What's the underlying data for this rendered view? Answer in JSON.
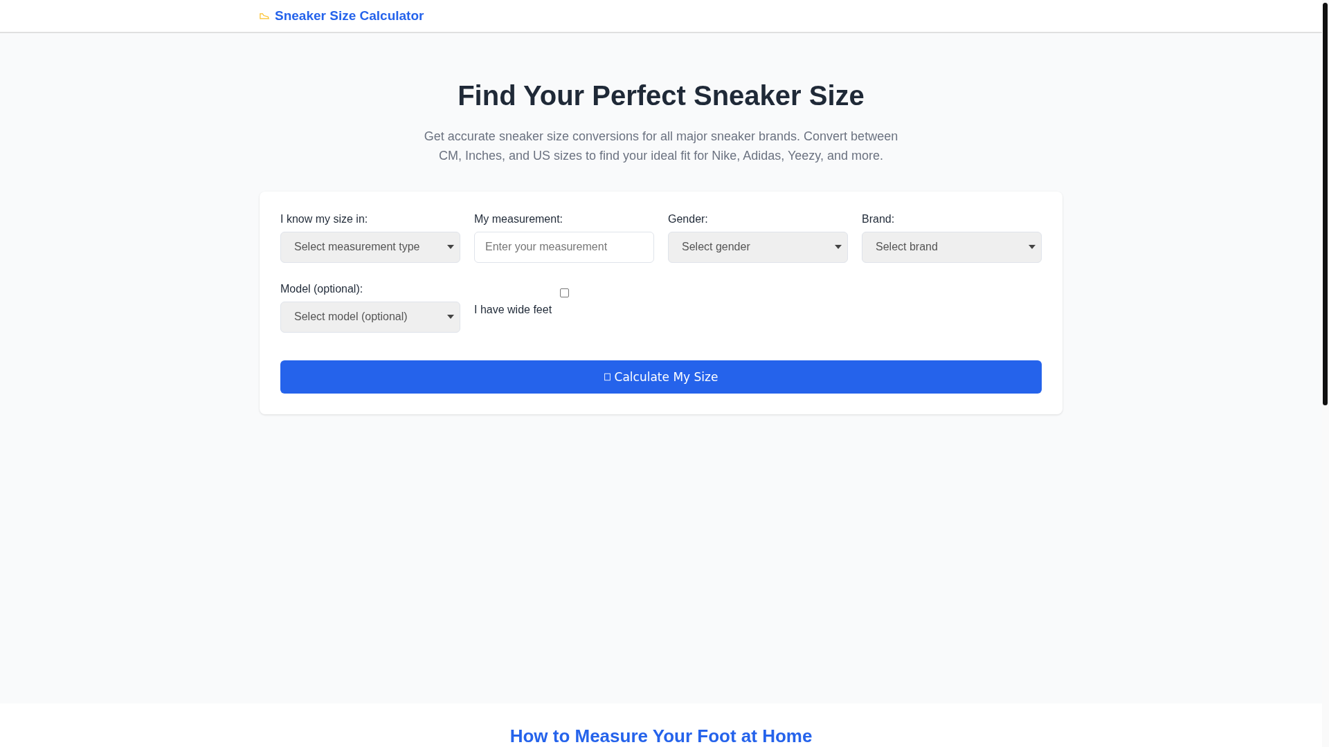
{
  "header": {
    "brand": "Sneaker Size Calculator"
  },
  "hero": {
    "title": "Find Your Perfect Sneaker Size",
    "subtitle": "Get accurate sneaker size conversions for all major sneaker brands. Convert between CM, Inches, and US sizes to find your ideal fit for Nike, Adidas, Yeezy, and more."
  },
  "form": {
    "fields": [
      {
        "kind": "select",
        "label": "I know my size in:",
        "placeholder": "Select measurement type"
      },
      {
        "kind": "input",
        "label": "My measurement:",
        "placeholder": "Enter your measurement"
      },
      {
        "kind": "select",
        "label": "Gender:",
        "placeholder": "Select gender"
      },
      {
        "kind": "select",
        "label": "Brand:",
        "placeholder": "Select brand"
      },
      {
        "kind": "select",
        "label": "Model (optional):",
        "placeholder": "Select model (optional)"
      },
      {
        "kind": "checkbox",
        "label": "I have wide feet",
        "checked": false
      }
    ],
    "button": "Calculate My Size"
  },
  "next_section": {
    "title": "How to Measure Your Foot at Home"
  }
}
